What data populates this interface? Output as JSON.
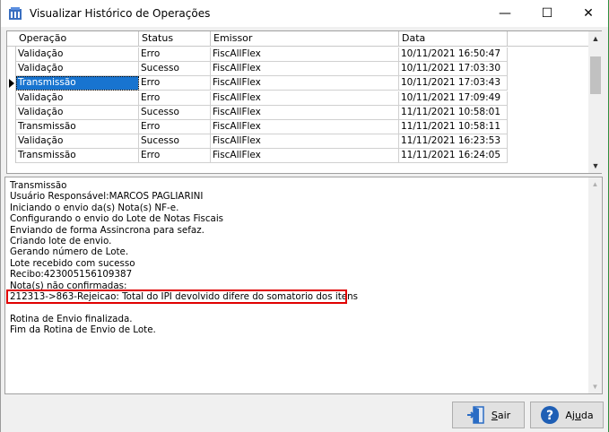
{
  "window": {
    "title": "Visualizar Histórico de Operações",
    "minimize_glyph": "—",
    "maximize_glyph": "☐",
    "close_glyph": "✕"
  },
  "grid": {
    "columns": [
      "Operação",
      "Status",
      "Emissor",
      "Data"
    ],
    "selected_row": 2,
    "rows": [
      {
        "operacao": "Validação",
        "status": "Erro",
        "emissor": "FiscAllFlex",
        "data": "10/11/2021 16:50:47"
      },
      {
        "operacao": "Validação",
        "status": "Sucesso",
        "emissor": "FiscAllFlex",
        "data": "10/11/2021 17:03:30"
      },
      {
        "operacao": "Transmissão",
        "status": "Erro",
        "emissor": "FiscAllFlex",
        "data": "10/11/2021 17:03:43"
      },
      {
        "operacao": "Validação",
        "status": "Erro",
        "emissor": "FiscAllFlex",
        "data": "10/11/2021 17:09:49"
      },
      {
        "operacao": "Validação",
        "status": "Sucesso",
        "emissor": "FiscAllFlex",
        "data": "11/11/2021 10:58:01"
      },
      {
        "operacao": "Transmissão",
        "status": "Erro",
        "emissor": "FiscAllFlex",
        "data": "11/11/2021 10:58:11"
      },
      {
        "operacao": "Validação",
        "status": "Sucesso",
        "emissor": "FiscAllFlex",
        "data": "11/11/2021 16:23:53"
      },
      {
        "operacao": "Transmissão",
        "status": "Erro",
        "emissor": "FiscAllFlex",
        "data": "11/11/2021 16:24:05"
      }
    ]
  },
  "log": {
    "lines": [
      "Transmissão",
      "Usuário Responsável:MARCOS PAGLIARINI",
      "Iniciando o envio da(s) Nota(s) NF-e.",
      "Configurando o envio do Lote de Notas Fiscais",
      "Enviando de forma Assincrona para sefaz.",
      "Criando lote de envio.",
      "Gerando número de Lote.",
      "Lote recebido com sucesso",
      "Recibo:423005156109387",
      "Nota(s) não confirmadas:",
      "212313->863-Rejeicao: Total do IPI devolvido difere do somatorio dos itens",
      "",
      "Rotina de Envio finalizada.",
      "Fim da Rotina de Envio de Lote."
    ],
    "highlighted_line_index": 10,
    "highlight_color": "#e00000"
  },
  "buttons": {
    "sair_first": "S",
    "sair_rest": "air",
    "ajuda_pre": "Aj",
    "ajuda_ul": "u",
    "ajuda_post": "da"
  },
  "colors": {
    "selection": "#1874d0",
    "help_icon": "#1f5fb5",
    "exit_icon": "#2a6cc4"
  }
}
